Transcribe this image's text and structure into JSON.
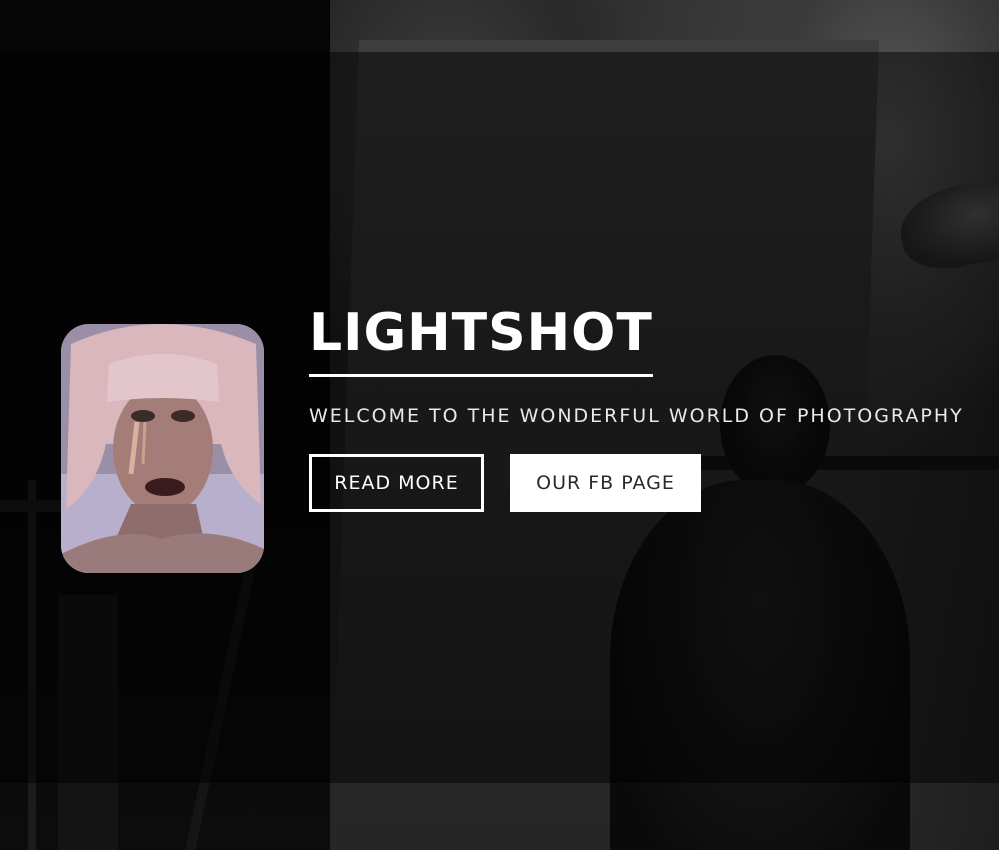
{
  "hero": {
    "title": "LIGHTSHOT",
    "tagline": "WELCOME TO THE WONDERFUL WORLD OF PHOTOGRAPHY",
    "buttons": {
      "read_more": "READ MORE",
      "fb_page": "OUR FB PAGE"
    }
  },
  "colors": {
    "text": "#ffffff",
    "solid_button_bg": "#ffffff",
    "solid_button_text": "#2a2a2a",
    "overlay": "rgba(0,0,0,0.48)"
  },
  "icons": {
    "portrait": "portrait-image"
  }
}
